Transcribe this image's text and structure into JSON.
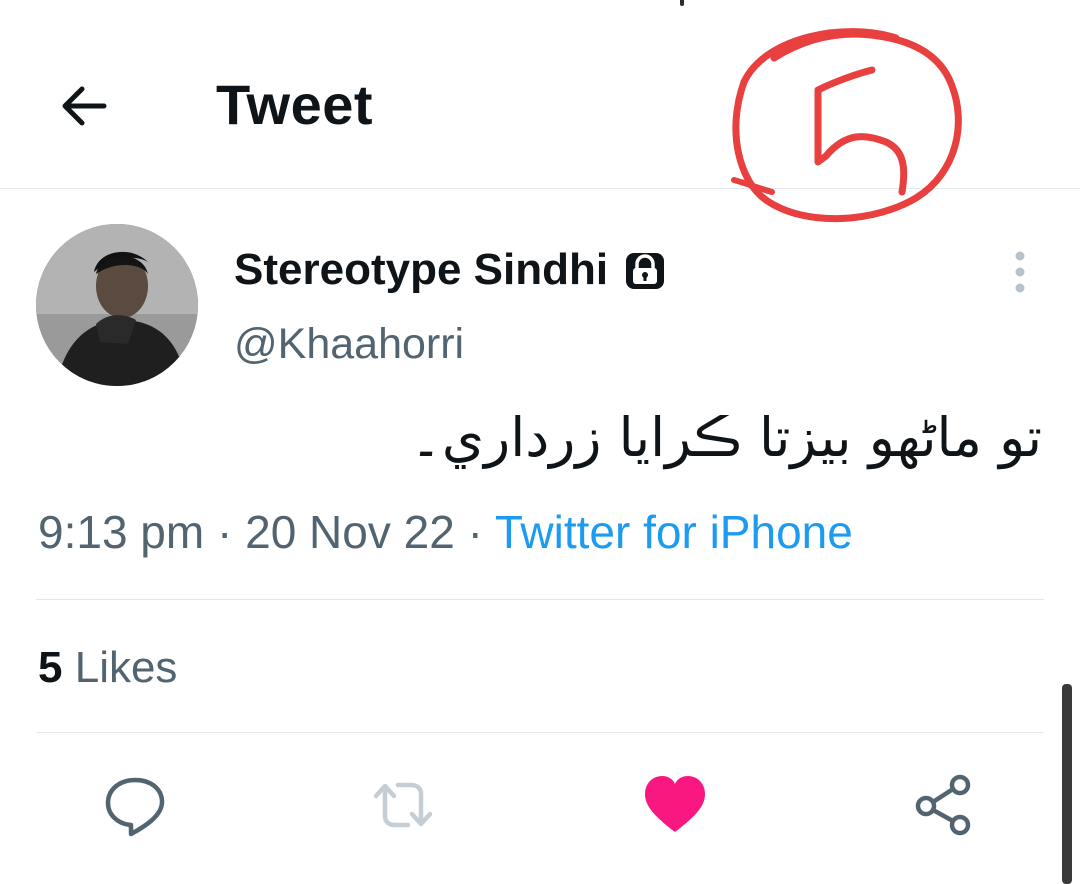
{
  "header": {
    "title": "Tweet",
    "back_icon": "arrow-left-icon"
  },
  "annotation": {
    "text": "5",
    "color": "#e8403f"
  },
  "tweet": {
    "author": {
      "display_name": "Stereotype Sindhi",
      "handle": "@Khaahorri",
      "protected_icon": "lock-icon"
    },
    "text": "تو ماڻھو بيزتا ڪرايا زرداري۔",
    "time": "9:13 pm",
    "separator": "·",
    "date": "20 Nov 22",
    "source": "Twitter for iPhone"
  },
  "stats": {
    "likes_count": "5",
    "likes_label": "Likes"
  },
  "actions": [
    {
      "name": "reply",
      "icon": "speech-bubble-icon"
    },
    {
      "name": "retweet",
      "icon": "retweet-arrows-icon"
    },
    {
      "name": "like",
      "icon": "heart-icon",
      "active": true
    },
    {
      "name": "share",
      "icon": "share-nodes-icon"
    }
  ],
  "colors": {
    "text_primary": "#0f1419",
    "text_secondary": "#536471",
    "link": "#1d9bf0",
    "like_active": "#f91880",
    "divider": "#e3e8ec",
    "icon_gray": "#536471"
  }
}
